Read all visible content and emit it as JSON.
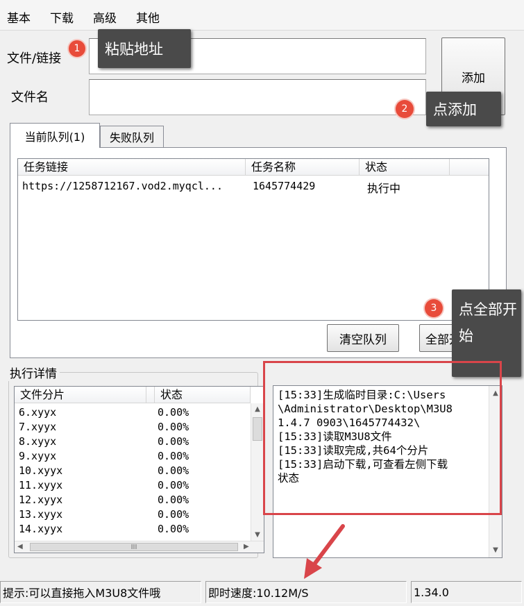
{
  "menu": [
    "基本",
    "下载",
    "高级",
    "其他"
  ],
  "form": {
    "url_label": "文件/链接",
    "url_value": "",
    "filename_label": "文件名",
    "filename_value": "",
    "add_button": "添加"
  },
  "tabs": [
    {
      "label": "当前队列(1)",
      "active": true
    },
    {
      "label": "失败队列",
      "active": false
    }
  ],
  "queue": {
    "columns": [
      "任务链接",
      "任务名称",
      "状态"
    ],
    "rows": [
      {
        "link": "https://1258712167.vod2.myqcl...",
        "name": "1645774429",
        "status": "执行中"
      }
    ]
  },
  "buttons": {
    "clear_queue": "清空队列",
    "start_all": "全部开始"
  },
  "details": {
    "title": "执行详情",
    "columns": [
      "文件分片",
      "状态"
    ],
    "rows": [
      {
        "file": "6.xyyx",
        "status": "0.00%"
      },
      {
        "file": "7.xyyx",
        "status": "0.00%"
      },
      {
        "file": "8.xyyx",
        "status": "0.00%"
      },
      {
        "file": "9.xyyx",
        "status": "0.00%"
      },
      {
        "file": "10.xyyx",
        "status": "0.00%"
      },
      {
        "file": "11.xyyx",
        "status": "0.00%"
      },
      {
        "file": "12.xyyx",
        "status": "0.00%"
      },
      {
        "file": "13.xyyx",
        "status": "0.00%"
      },
      {
        "file": "14.xyyx",
        "status": "0.00%"
      }
    ],
    "hscroll_grip": "III"
  },
  "log": [
    "[15:33]生成临时目录:C:\\Users",
    "\\Administrator\\Desktop\\M3U8",
    "1.4.7 0903\\1645774432\\",
    "[15:33]读取M3U8文件",
    "[15:33]读取完成,共64个分片",
    "[15:33]启动下载,可查看左侧下载",
    "状态"
  ],
  "status": {
    "tip": "提示:可以直接拖入M3U8文件哦",
    "speed": "即时速度:10.12M/S",
    "version": "1.34.0"
  },
  "annotations": {
    "step1": {
      "number": "1",
      "text": "粘贴地址"
    },
    "step2": {
      "number": "2",
      "text": "点添加"
    },
    "step3": {
      "number": "3",
      "text": "点全部开始"
    }
  },
  "colors": {
    "annotation_red": "#d9454a",
    "callout_bg": "#4a4a4a",
    "badge_red": "#e84b3a"
  }
}
